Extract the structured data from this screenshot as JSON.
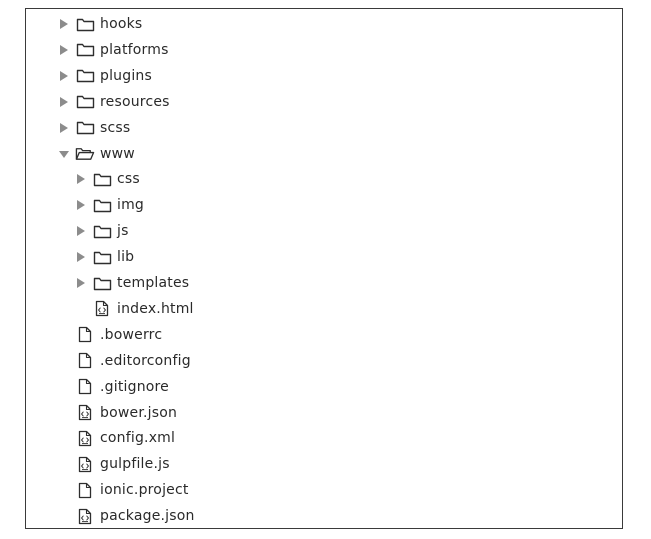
{
  "tree": {
    "items": [
      {
        "label": "hooks",
        "kind": "folder",
        "state": "collapsed",
        "depth": 0,
        "icon": "folder-icon"
      },
      {
        "label": "platforms",
        "kind": "folder",
        "state": "collapsed",
        "depth": 0,
        "icon": "folder-icon"
      },
      {
        "label": "plugins",
        "kind": "folder",
        "state": "collapsed",
        "depth": 0,
        "icon": "folder-icon"
      },
      {
        "label": "resources",
        "kind": "folder",
        "state": "collapsed",
        "depth": 0,
        "icon": "folder-icon"
      },
      {
        "label": "scss",
        "kind": "folder",
        "state": "collapsed",
        "depth": 0,
        "icon": "folder-icon"
      },
      {
        "label": "www",
        "kind": "folder",
        "state": "expanded",
        "depth": 0,
        "icon": "folder-open-icon"
      },
      {
        "label": "css",
        "kind": "folder",
        "state": "collapsed",
        "depth": 1,
        "icon": "folder-icon"
      },
      {
        "label": "img",
        "kind": "folder",
        "state": "collapsed",
        "depth": 1,
        "icon": "folder-icon"
      },
      {
        "label": "js",
        "kind": "folder",
        "state": "collapsed",
        "depth": 1,
        "icon": "folder-icon"
      },
      {
        "label": "lib",
        "kind": "folder",
        "state": "collapsed",
        "depth": 1,
        "icon": "folder-icon"
      },
      {
        "label": "templates",
        "kind": "folder",
        "state": "collapsed",
        "depth": 1,
        "icon": "folder-icon"
      },
      {
        "label": "index.html",
        "kind": "file",
        "depth": 1,
        "icon": "code-file-icon"
      },
      {
        "label": ".bowerrc",
        "kind": "file",
        "depth": 0,
        "icon": "file-icon"
      },
      {
        "label": ".editorconfig",
        "kind": "file",
        "depth": 0,
        "icon": "file-icon"
      },
      {
        "label": ".gitignore",
        "kind": "file",
        "depth": 0,
        "icon": "file-icon"
      },
      {
        "label": "bower.json",
        "kind": "file",
        "depth": 0,
        "icon": "code-file-icon"
      },
      {
        "label": "config.xml",
        "kind": "file",
        "depth": 0,
        "icon": "code-file-icon"
      },
      {
        "label": "gulpfile.js",
        "kind": "file",
        "depth": 0,
        "icon": "code-file-icon"
      },
      {
        "label": "ionic.project",
        "kind": "file",
        "depth": 0,
        "icon": "file-icon"
      },
      {
        "label": "package.json",
        "kind": "file",
        "depth": 0,
        "icon": "code-file-icon"
      }
    ]
  }
}
